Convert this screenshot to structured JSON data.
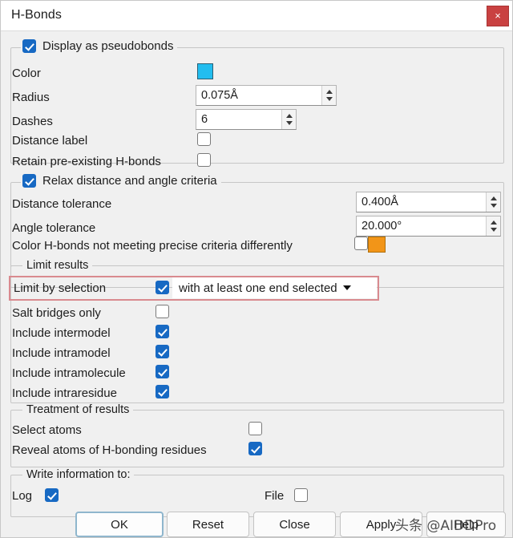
{
  "window": {
    "title": "H-Bonds",
    "close_label": "×"
  },
  "pseudobonds": {
    "group_label": "Display as pseudobonds",
    "group_checked": true,
    "color_label": "Color",
    "color_value": "#22bdef",
    "radius_label": "Radius",
    "radius_value": "0.075Å",
    "dashes_label": "Dashes",
    "dashes_value": "6",
    "distance_label_label": "Distance label",
    "distance_label_checked": false,
    "retain_label": "Retain pre-existing H-bonds",
    "retain_checked": false
  },
  "relax": {
    "group_label": "Relax distance and angle criteria",
    "group_checked": true,
    "distance_tolerance_label": "Distance tolerance",
    "distance_tolerance_value": "0.400Å",
    "angle_tolerance_label": "Angle tolerance",
    "angle_tolerance_value": "20.000°",
    "color_differently_label": "Color H-bonds not meeting precise criteria differently",
    "color_differently_checked": false,
    "color_differently_value": "#f29518"
  },
  "limit_results": {
    "group_label": "Limit results",
    "limit_by_selection_label": "Limit by selection",
    "limit_by_selection_checked": true,
    "selection_mode_value": "with at least one end selected",
    "salt_bridges_label": "Salt bridges only",
    "salt_bridges_checked": false,
    "intermodel_label": "Include intermodel",
    "intermodel_checked": true,
    "intramodel_label": "Include intramodel",
    "intramodel_checked": true,
    "intramolecule_label": "Include intramolecule",
    "intramolecule_checked": true,
    "intraresidue_label": "Include intraresidue",
    "intraresidue_checked": true,
    "highlight_color": "#d98a8f"
  },
  "treatment": {
    "group_label": "Treatment of results",
    "select_atoms_label": "Select atoms",
    "select_atoms_checked": false,
    "reveal_atoms_label": "Reveal atoms of H-bonding residues",
    "reveal_atoms_checked": true
  },
  "write_info": {
    "group_label": "Write information to:",
    "log_label": "Log",
    "log_checked": true,
    "file_label": "File",
    "file_checked": false
  },
  "buttons": {
    "ok": "OK",
    "reset": "Reset",
    "close": "Close",
    "apply": "Apply",
    "help": "Help"
  },
  "watermark": {
    "text": "头条 @AIDDPro"
  }
}
